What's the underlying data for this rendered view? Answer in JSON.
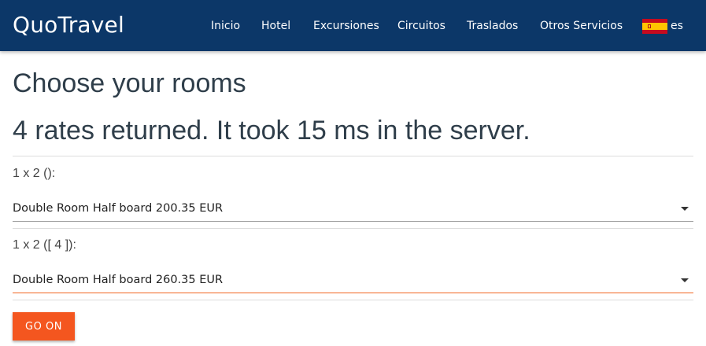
{
  "navbar": {
    "brand": "QuoTravel",
    "links": [
      "Inicio",
      "Hotel",
      "Excursiones",
      "Circuitos",
      "Traslados",
      "Otros Servicios"
    ],
    "language": {
      "code": "es",
      "flag": "spain-flag-icon"
    }
  },
  "page": {
    "title": "Choose your rooms",
    "summary": "4 rates returned. It took 15 ms in the server."
  },
  "rooms": [
    {
      "label": "1 x 2 ():",
      "selected_rate": "Double Room Half board 200.35 EUR"
    },
    {
      "label": "1 x 2 ([ 4 ]):",
      "selected_rate": "Double Room Half board 260.35 EUR"
    }
  ],
  "actions": {
    "go_on_label": "GO ON"
  },
  "colors": {
    "navbar": "#0c3768",
    "accent": "#f4561f",
    "heading": "#2f3e4a"
  }
}
